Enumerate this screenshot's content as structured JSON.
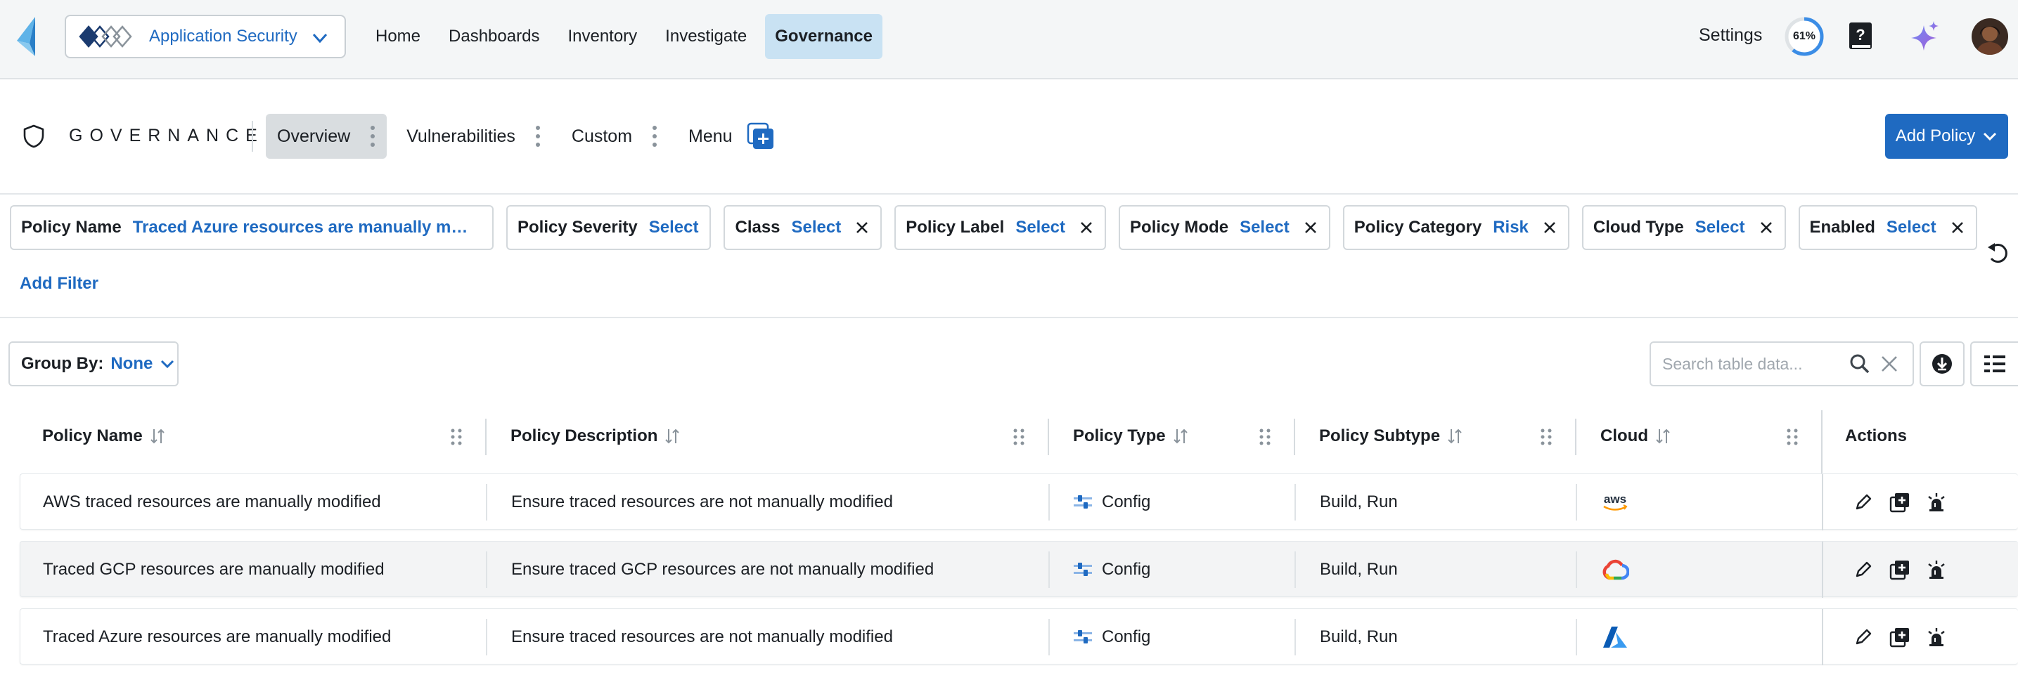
{
  "nav": {
    "app_name": "Application Security",
    "links": [
      "Home",
      "Dashboards",
      "Inventory",
      "Investigate",
      "Governance"
    ],
    "active_link": "Governance",
    "settings_label": "Settings",
    "progress_label": "61%",
    "progress_value": 0.61
  },
  "header": {
    "title": "GOVERNANCE",
    "tabs": [
      "Overview",
      "Vulnerabilities",
      "Custom",
      "Menu"
    ],
    "active_tab": "Overview",
    "add_policy_label": "Add Policy"
  },
  "filters": {
    "chips": [
      {
        "label": "Policy Name",
        "value": "Traced Azure resources are manually modifi…",
        "removable": false
      },
      {
        "label": "Policy Severity",
        "value": "Select",
        "removable": false
      },
      {
        "label": "Class",
        "value": "Select",
        "removable": true
      },
      {
        "label": "Policy Label",
        "value": "Select",
        "removable": true
      },
      {
        "label": "Policy Mode",
        "value": "Select",
        "removable": true
      },
      {
        "label": "Policy Category",
        "value": "Risk",
        "removable": true
      },
      {
        "label": "Cloud Type",
        "value": "Select",
        "removable": true
      },
      {
        "label": "Enabled",
        "value": "Select",
        "removable": true
      }
    ],
    "add_filter_label": "Add Filter"
  },
  "toolbar": {
    "group_by_label": "Group By:",
    "group_by_value": "None",
    "search_placeholder": "Search table data..."
  },
  "table": {
    "columns": [
      "Policy Name",
      "Policy Description",
      "Policy Type",
      "Policy Subtype",
      "Cloud",
      "Actions"
    ],
    "rows": [
      {
        "name": "AWS traced resources are manually modified",
        "description": "Ensure traced resources are not manually modified",
        "type": "Config",
        "subtype": "Build, Run",
        "cloud": "aws",
        "cloud_icon": "aws-logo-icon"
      },
      {
        "name": "Traced GCP resources are manually modified",
        "description": "Ensure traced GCP resources are not manually modified",
        "type": "Config",
        "subtype": "Build, Run",
        "cloud": "gcp",
        "cloud_icon": "gcp-logo-icon"
      },
      {
        "name": "Traced Azure resources are manually modified",
        "description": "Ensure traced resources are not manually modified",
        "type": "Config",
        "subtype": "Build, Run",
        "cloud": "azure",
        "cloud_icon": "azure-logo-icon"
      }
    ]
  },
  "colors": {
    "accent": "#1f6ac1",
    "nav_bg": "#f4f6f7",
    "active_nav_bg": "#c9e2f3",
    "active_tab_bg": "#d9dde0",
    "gauge": "#3b8de6"
  }
}
